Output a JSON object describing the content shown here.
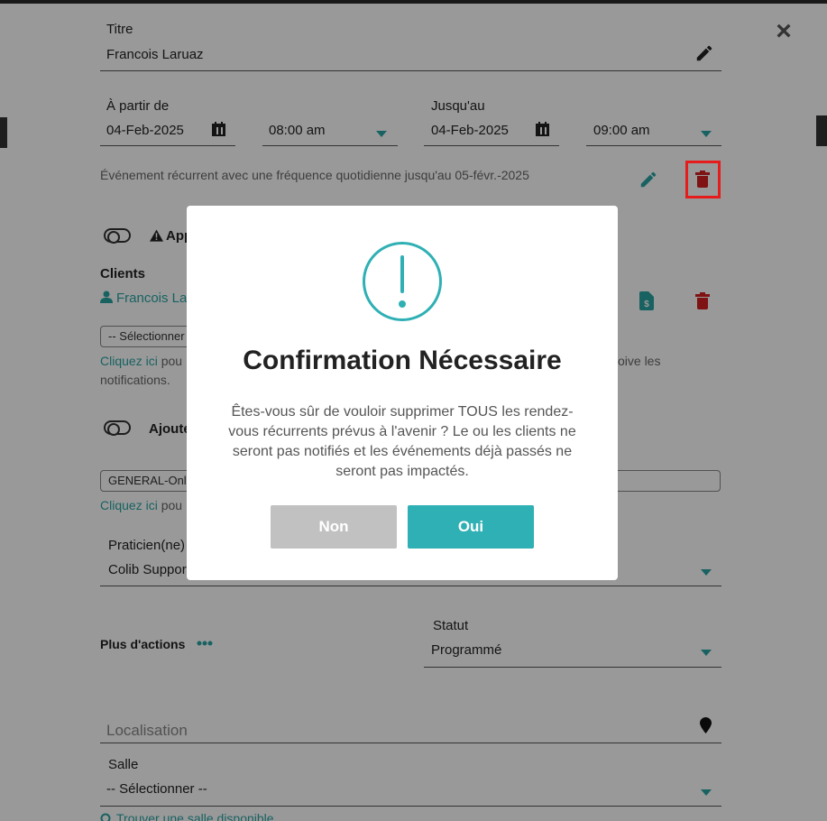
{
  "form": {
    "title_label": "Titre",
    "title_value": "Francois Laruaz",
    "from_label": "À partir de",
    "from_date": "04-Feb-2025",
    "from_time": "08:00 am",
    "to_label": "Jusqu'au",
    "to_date": "04-Feb-2025",
    "to_time": "09:00 am",
    "recurrence_text": "Événement récurrent avec une fréquence quotidienne jusqu'au 05-févr.-2025",
    "appointment_toggle_label": "App",
    "clients_label": "Clients",
    "client_name": "Francois Lar",
    "client_select_placeholder": "-- Sélectionner",
    "click_here": "Cliquez ici",
    "click_here_rest": " pou",
    "notif_tail": "oive les",
    "notifications_text": "notifications.",
    "add_toggle_label": "Ajoute",
    "general_select_value": "GENERAL-Only",
    "click_here_2": "Cliquez ici",
    "click_here_2_rest": " pou",
    "practitioner_label": "Praticien(ne)",
    "practitioner_value": "Colib Support",
    "more_actions_label": "Plus d'actions",
    "status_label": "Statut",
    "status_value": "Programmé",
    "location_placeholder": "Localisation",
    "room_label": "Salle",
    "room_value": "-- Sélectionner --",
    "find_room_link": "Trouver une salle disponible"
  },
  "dialog": {
    "title": "Confirmation Nécessaire",
    "message": "Êtes-vous sûr de vouloir supprimer TOUS les rendez-vous récurrents prévus à l'avenir ? Le ou les clients ne seront pas notifiés et les événements déjà passés ne seront pas impactés.",
    "cancel_label": "Non",
    "confirm_label": "Oui"
  },
  "colors": {
    "accent": "#2fb0b4",
    "danger": "#d41e1e",
    "highlight": "#e61c1c"
  }
}
